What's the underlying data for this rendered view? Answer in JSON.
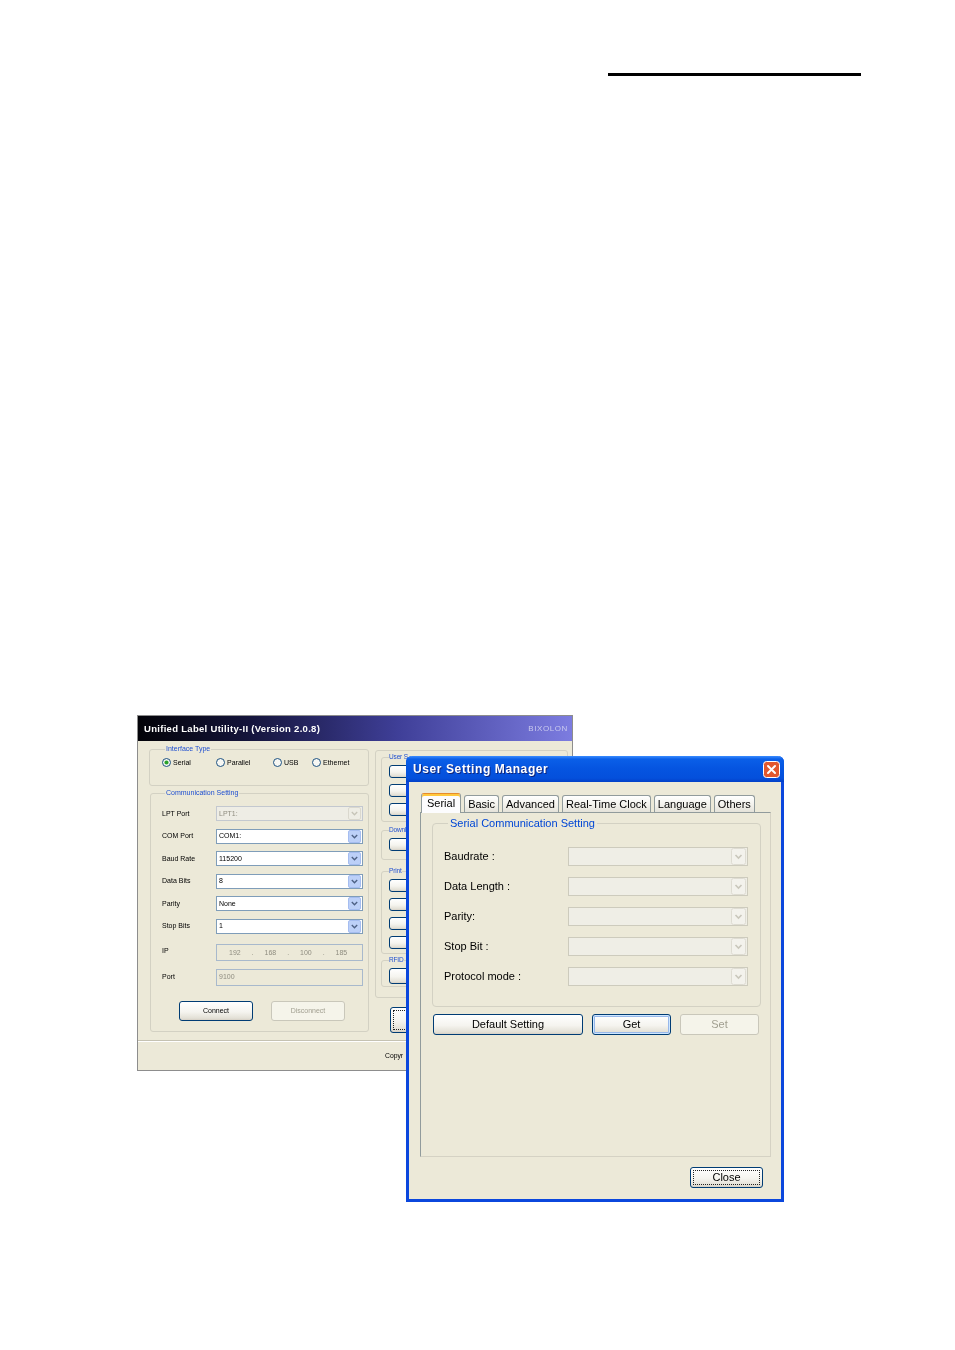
{
  "main_window": {
    "title": "Unified Label Utility-II (Version 2.0.8)",
    "brand": "BIXOLON",
    "interface_type": {
      "legend": "Interface Type",
      "options": [
        {
          "label": "Serial",
          "selected": true
        },
        {
          "label": "Parallel",
          "selected": false
        },
        {
          "label": "USB",
          "selected": false
        },
        {
          "label": "Ethernet",
          "selected": false
        }
      ]
    },
    "communication_setting": {
      "legend": "Communication Setting",
      "fields": [
        {
          "kind": "combo",
          "label": "LPT Port",
          "value": "LPT1:",
          "disabled": true
        },
        {
          "kind": "combo",
          "label": "COM Port",
          "value": "COM1:",
          "disabled": false
        },
        {
          "kind": "combo",
          "label": "Baud Rate",
          "value": "115200",
          "disabled": false
        },
        {
          "kind": "combo",
          "label": "Data Bits",
          "value": "8",
          "disabled": false
        },
        {
          "kind": "combo",
          "label": "Parity",
          "value": "None",
          "disabled": false
        },
        {
          "kind": "combo",
          "label": "Stop Bits",
          "value": "1",
          "disabled": false
        },
        {
          "kind": "ip",
          "label": "IP",
          "value": "192 . 168 . 100 . 185",
          "disabled": true
        },
        {
          "kind": "text",
          "label": "Port",
          "value": "9100",
          "disabled": true
        }
      ],
      "buttons": [
        {
          "label": "Connect",
          "disabled": false
        },
        {
          "label": "Disconnect",
          "disabled": true
        }
      ]
    },
    "side_groups": [
      {
        "legend": "User S",
        "buttons": [
          {
            "kind": "button"
          },
          {
            "kind": "button"
          },
          {
            "kind": "button"
          }
        ]
      },
      {
        "legend": "Downl",
        "buttons": [
          {
            "kind": "button"
          }
        ]
      },
      {
        "legend": "Print",
        "buttons": [
          {
            "kind": "button"
          },
          {
            "kind": "button"
          },
          {
            "kind": "button"
          },
          {
            "kind": "button"
          }
        ]
      },
      {
        "legend": "RFID",
        "buttons": [
          {
            "kind": "button"
          }
        ]
      }
    ],
    "focused_button": {
      "focused": true
    },
    "status_text": "Copyr"
  },
  "dialog": {
    "title": "User Setting Manager",
    "tabs": [
      {
        "label": "Serial",
        "selected": true
      },
      {
        "label": "Basic",
        "selected": false
      },
      {
        "label": "Advanced",
        "selected": false
      },
      {
        "label": "Real-Time Clock",
        "selected": false
      },
      {
        "label": "Language",
        "selected": false
      },
      {
        "label": "Others",
        "selected": false
      }
    ],
    "group": {
      "legend": "Serial Communication Setting",
      "fields": [
        {
          "label": "Baudrate :",
          "disabled": true
        },
        {
          "label": "Data Length :",
          "disabled": true
        },
        {
          "label": "Parity:",
          "disabled": true
        },
        {
          "label": "Stop Bit :",
          "disabled": true
        },
        {
          "label": "Protocol mode :",
          "disabled": true
        }
      ]
    },
    "buttons": [
      {
        "label": "Default Setting",
        "disabled": false,
        "default": false
      },
      {
        "label": "Get",
        "disabled": false,
        "default": true
      },
      {
        "label": "Set",
        "disabled": true,
        "default": false
      }
    ],
    "close_button": {
      "label": "Close",
      "focused": true
    }
  }
}
